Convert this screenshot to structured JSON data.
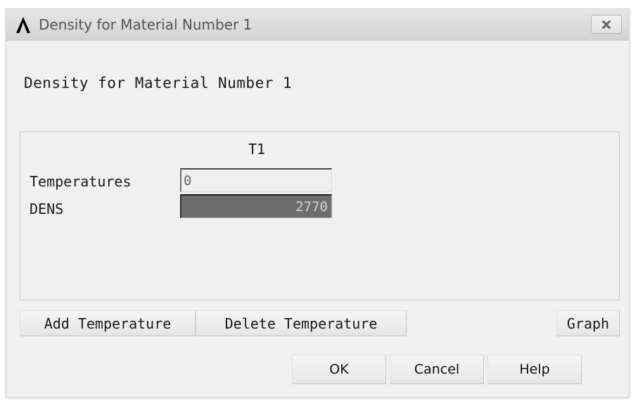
{
  "window": {
    "title": "Density for Material Number 1",
    "app_icon": "ansys-lambda-icon",
    "close_label": "✖"
  },
  "content": {
    "heading": "Density for Material Number 1"
  },
  "table": {
    "column_headers": [
      "T1"
    ],
    "rows": [
      {
        "label": "Temperatures",
        "value": "0",
        "selected": false
      },
      {
        "label": "DENS",
        "value": "2770",
        "selected": true
      }
    ]
  },
  "actions": {
    "add_temperature": "Add Temperature",
    "delete_temperature": "Delete Temperature",
    "graph": "Graph"
  },
  "dialog_buttons": {
    "ok": "OK",
    "cancel": "Cancel",
    "help": "Help"
  },
  "colors": {
    "selected_cell_bg": "#6e6e6e",
    "selected_cell_text": "#d4d4d4",
    "field_bg": "#eeeeee",
    "titlebar_bg": "#dcdcdc",
    "window_bg": "#f0f0f0"
  }
}
